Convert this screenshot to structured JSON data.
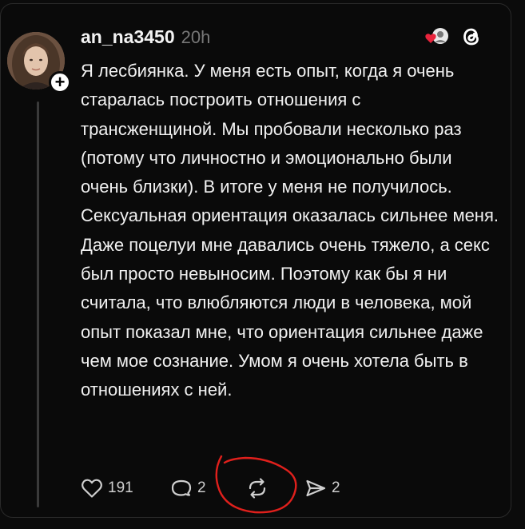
{
  "post": {
    "username": "an_na3450",
    "timestamp": "20h",
    "text": "Я лесбиянка. У меня есть опыт, когда я очень старалась построить отношения с трансженщиной. Мы пробовали несколько раз (потому что личностно и эмоционально были очень близки). В итоге у меня не получилось. Сексуальная ориентация оказалась сильнее меня. Даже поцелуи мне давались очень тяжело, а секс был просто невыносим. Поэтому как бы я ни считала, что влюбляются люди в человека, мой опыт показал мне, что ориентация сильнее даже чем мое сознание. Умом я очень хотела быть в отношениях с ней."
  },
  "actions": {
    "likes": "191",
    "replies": "2",
    "shares": "2"
  },
  "icons": {
    "like": "heart-icon",
    "reply": "comment-icon",
    "repost": "repost-icon",
    "share": "send-icon",
    "app": "threads-logo-icon",
    "liked_by": "liked-by-avatar-icon",
    "follow": "plus-icon",
    "annotation": "red-circle-annotation"
  },
  "colors": {
    "background": "#0a0a0a",
    "text": "#f1f1f1",
    "muted": "#777777",
    "like_red": "#e8243c",
    "annotation_red": "#e0201c"
  }
}
